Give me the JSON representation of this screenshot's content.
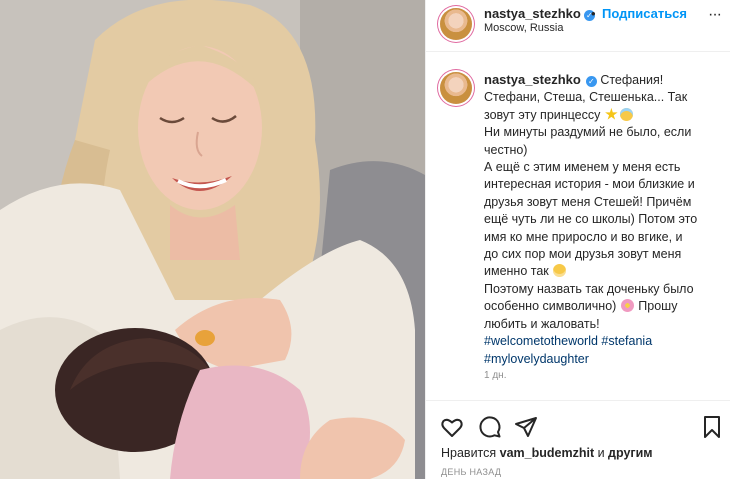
{
  "header": {
    "username": "nastya_stezhko",
    "separator": "•",
    "follow_label": "Подписаться",
    "location": "Moscow, Russia",
    "more_label": "···"
  },
  "caption": {
    "username": "nastya_stezhko",
    "lines": [
      "Стефания!",
      "Стефани, Стеша, Стешенька... Так",
      "зовут эту принцессу",
      "Ни минуты раздумий не было, если",
      "честно)",
      "А ещё с этим именем у меня есть",
      "интересная история - мои близкие и",
      "друзья зовут меня Стешей! Причём",
      "ещё чуть ли не со школы) Потом это",
      "имя ко мне приросло и во вгике, и",
      "до сих пор мои друзья зовут меня",
      "именно так",
      "Поэтому назвать так доченьку было",
      "особенно символично)",
      "Прошу",
      "любить и жаловать!"
    ],
    "hashtags_line1": "#welcometotheworld #stefania",
    "hashtags_line2": "#mylovelydaughter",
    "time": "1 дн."
  },
  "actions": {
    "liked_by_prefix": "Нравится ",
    "liked_by_user": "vam_budemzhit",
    "liked_by_and": " и ",
    "liked_by_others": "другим",
    "time_ago": "ДЕНЬ НАЗАД"
  },
  "icons": {
    "like": "heart-icon",
    "comment": "comment-icon",
    "share": "paper-plane-icon",
    "save": "bookmark-icon",
    "verified": "verified-badge-icon",
    "star_emoji": "star-emoji-icon",
    "angel_emoji": "angel-emoji-icon",
    "grin_emoji": "grinning-emoji-icon",
    "flower_emoji": "blossom-emoji-icon"
  },
  "colors": {
    "accent": "#0095f6",
    "hashtag": "#00376b",
    "muted": "#8e8e8e",
    "verified": "#3897f0"
  }
}
